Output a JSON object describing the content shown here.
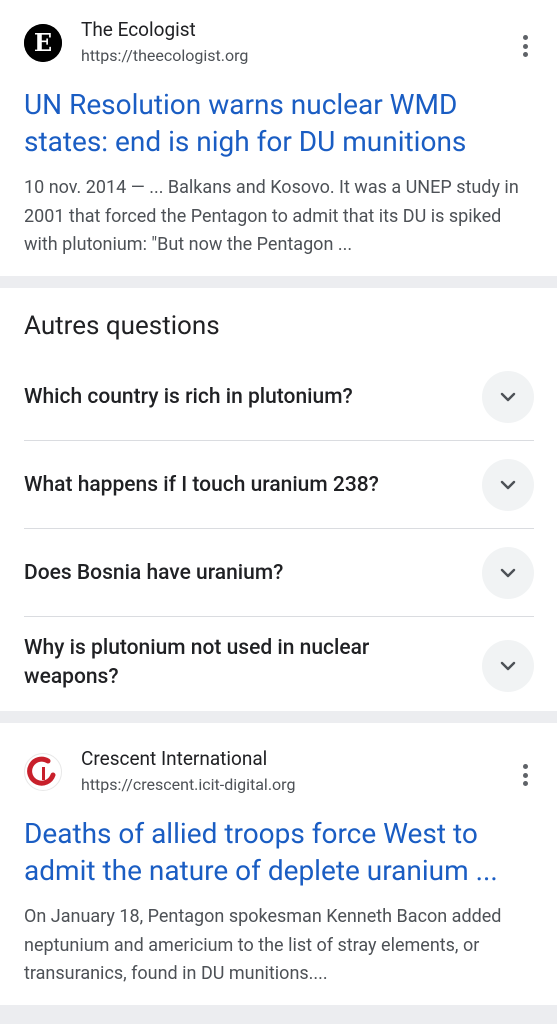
{
  "results": [
    {
      "site_name": "The Ecologist",
      "url": "https://theecologist.org",
      "title": "UN Resolution warns nuclear WMD states: end is nigh for DU munitions",
      "snippet": "10 nov. 2014 — ... Balkans and Kosovo. It was a UNEP study in 2001 that forced the Pentagon to admit that its DU is spiked with plutonium: \"But now the Pentagon ...",
      "favicon_letter": "E"
    },
    {
      "site_name": "Crescent International",
      "url": "https://crescent.icit-digital.org",
      "title": "Deaths of allied troops force West to admit the nature of deplete uranium ...",
      "snippet": "On January 18, Pentagon spokesman Kenneth Bacon added neptunium and americium to the list of stray elements, or transuranics, found in DU munitions...."
    }
  ],
  "paa": {
    "heading": "Autres questions",
    "questions": [
      "Which country is rich in plutonium?",
      "What happens if I touch uranium 238?",
      "Does Bosnia have uranium?",
      "Why is plutonium not used in nuclear weapons?"
    ]
  },
  "colors": {
    "link": "#1a5dc3",
    "separator": "#ecedf0",
    "chevron_bg": "#f1f3f4"
  },
  "icons": [
    "ecologist-logo-icon",
    "more-vert-icon",
    "chevron-down-icon",
    "crescent-logo-icon"
  ]
}
